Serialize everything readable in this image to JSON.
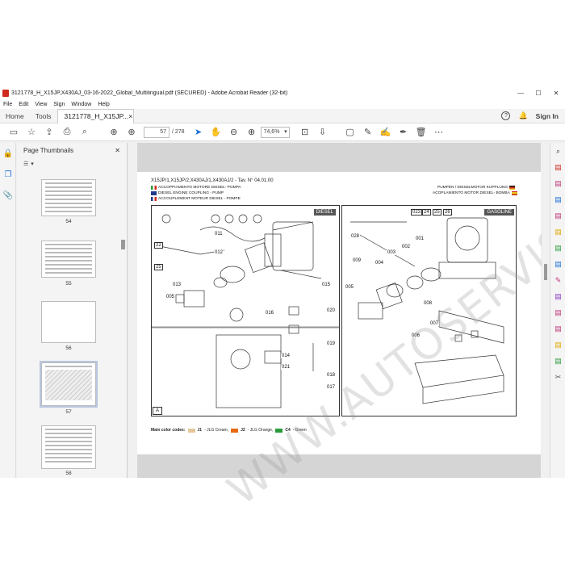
{
  "window": {
    "title": "3121778_H_X15JP,X430AJ_03-16-2022_Global_Multilingual.pdf (SECURED) - Adobe Acrobat Reader (32-bit)",
    "min_glyph": "—",
    "max_glyph": "☐",
    "close_glyph": "✕"
  },
  "menu": [
    "File",
    "Edit",
    "View",
    "Sign",
    "Window",
    "Help"
  ],
  "tabs": {
    "home": "Home",
    "tools": "Tools",
    "document": "3121778_H_X15JP...",
    "doc_close": "×",
    "sign_in": "Sign In",
    "help_glyph": "?",
    "bell_glyph": "🔔"
  },
  "toolbar": {
    "page_current": "57",
    "page_total": "/ 278",
    "zoom": "74,6%",
    "zoom_caret": "▾"
  },
  "thumbnails": {
    "title": "Page Thumbnails",
    "close": "✕",
    "options_caret": "▾",
    "pages": [
      "54",
      "55",
      "56",
      "57",
      "58"
    ]
  },
  "document": {
    "header": "X15JP/1,X15JP/2,X430AJ/1,X430AJ/2 - Tav. N° 04.01.00",
    "left_langs": [
      "ACCOPPIAMENTO MOTORE  DIESEL- POMPA",
      "DIESEL ENGINE COUPLING - PUMP",
      "ACCOUPLEMENT  MOTEUR DIESEL - POMPE"
    ],
    "right_langs": [
      "PUMPEN / DIESELMOTOR KUPPLUNG",
      "ACOPLAMIENTO MOTOR DIESEL- BOMBA"
    ],
    "diesel_tag": "DIESEL",
    "gasoline_tag": "GASOLINE",
    "detail_tag": "A",
    "callouts_left": [
      "22",
      "25",
      "011",
      "012",
      "013",
      "005",
      "015",
      "016",
      "020"
    ],
    "callouts_right": [
      "028",
      "009",
      "004",
      "003",
      "002",
      "001",
      "005",
      "008",
      "007",
      "006",
      "023",
      "24",
      "25",
      "26"
    ],
    "callouts_detail": [
      "019",
      "014",
      "021",
      "018",
      "017"
    ],
    "color_codes_label": "Main color codes:",
    "color_codes": [
      {
        "code": "J1",
        "name": " - JLG Cream,",
        "color": "#e3c99a"
      },
      {
        "code": "J2",
        "name": " - JLG Orange,",
        "color": "#e86a10"
      },
      {
        "code": "C4",
        "name": " - Green",
        "color": "#2a9a3a"
      }
    ],
    "watermark": "WWW.AUTOSERVISDO.COM"
  },
  "icons": {
    "left_rail": [
      "lock-icon",
      "pages-icon",
      "attachment-icon"
    ],
    "right_rail_colors": [
      "#d02a1e",
      "#c0367a",
      "#1a6ed8",
      "#c0367a",
      "#e0a800",
      "#2a9a3a",
      "#1a6ed8",
      "#c0367a",
      "#8a3ac0",
      "#c0367a",
      "#c0367a",
      "#e0a800",
      "#2a9a3a",
      "#555555"
    ]
  }
}
